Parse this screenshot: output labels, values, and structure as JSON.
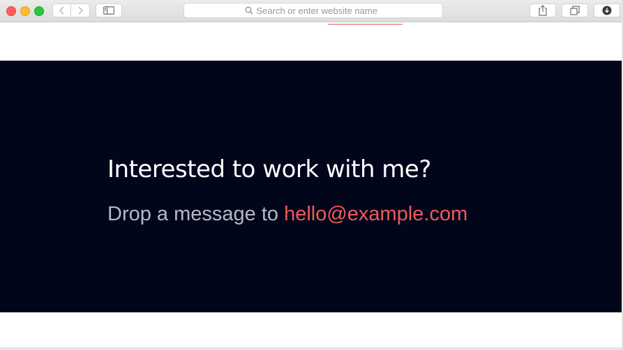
{
  "browser": {
    "address_bar": {
      "placeholder": "Search or enter website name"
    },
    "icons": {
      "back": "chevron-left-icon",
      "forward": "chevron-right-icon",
      "sidebar": "sidebar-icon",
      "search": "search-icon",
      "share": "share-icon",
      "tabs": "tabs-overview-icon",
      "download": "download-icon"
    }
  },
  "cta": {
    "title": "Interested to work with me?",
    "subtitle_prefix": "Drop a message to ",
    "email": "hello@example.com"
  },
  "colors": {
    "cta_background": "#01061b",
    "accent": "#ef5a5a",
    "title": "#ffffff",
    "subtitle": "#b6b9c5"
  }
}
